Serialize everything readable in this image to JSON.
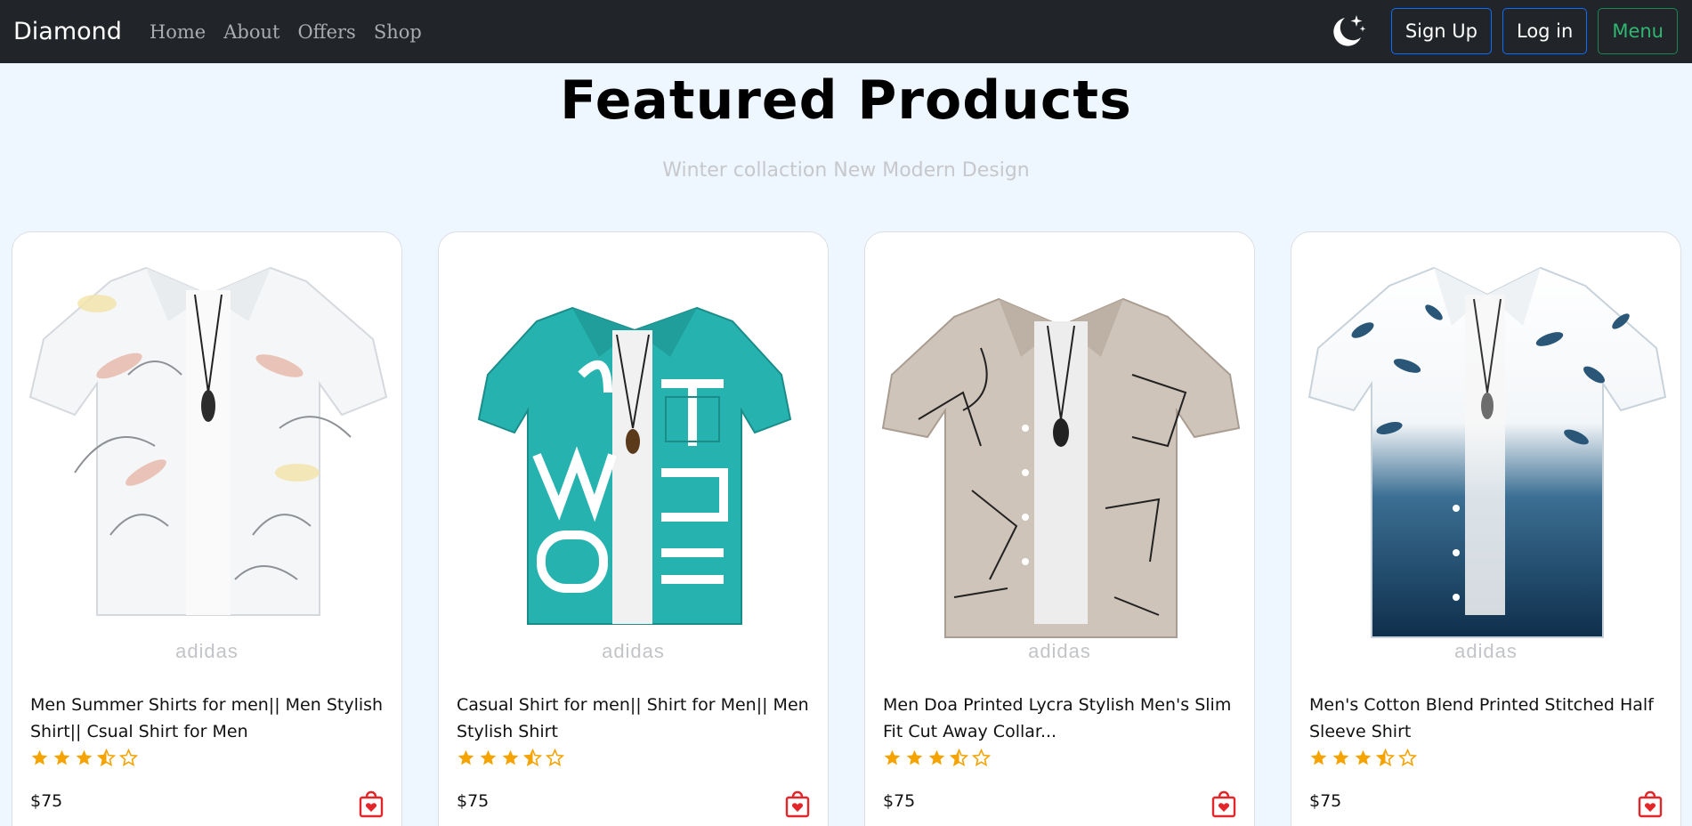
{
  "navbar": {
    "brand": "Diamond",
    "links": [
      "Home",
      "About",
      "Offers",
      "Shop"
    ],
    "signup_label": "Sign Up",
    "login_label": "Log in",
    "menu_label": "Menu",
    "theme_icon": "moon-stars-icon"
  },
  "header": {
    "title": "Featured Products",
    "subtitle": "Winter collaction New Modern Design"
  },
  "colors": {
    "navbar_bg": "#212529",
    "page_bg": "#eef6ff",
    "star": "#f5a300",
    "cart": "#e3262a",
    "primary_border": "#0d6efd",
    "success_border": "#198754"
  },
  "products": [
    {
      "brand": "adidas",
      "name": "Men Summer Shirts for men|| Men Stylish Shirt|| Csual Shirt for Men",
      "price": "$75",
      "rating": 3.5
    },
    {
      "brand": "adidas",
      "name": "Casual Shirt for men|| Shirt for Men|| Men Stylish Shirt",
      "price": "$75",
      "rating": 3.5
    },
    {
      "brand": "adidas",
      "name": "Men Doa Printed Lycra Stylish Men's Slim Fit Cut Away Collar...",
      "price": "$75",
      "rating": 3.5
    },
    {
      "brand": "adidas",
      "name": "Men's Cotton Blend Printed Stitched Half Sleeve Shirt",
      "price": "$75",
      "rating": 3.5
    }
  ]
}
